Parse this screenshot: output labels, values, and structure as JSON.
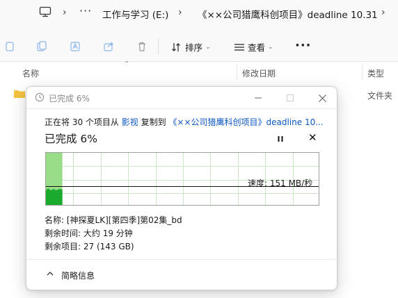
{
  "address_bar": {
    "breadcrumb": [
      "工作与学习 (E:)",
      "《××公司猎鹰科创项目》deadline 10.31"
    ],
    "more": "···"
  },
  "toolbar": {
    "sort_label": "排序",
    "view_label": "查看",
    "more": "···"
  },
  "file_list": {
    "columns": [
      "名称",
      "修改日期",
      "类型"
    ],
    "rows": [
      {
        "type": "文件夹"
      }
    ]
  },
  "copy_dialog": {
    "title": "已完成 6%",
    "copy_prefix": "正在将 30 个项目从",
    "source": "影视",
    "copy_mid": "复制到",
    "destination": "《××公司猎鹰科创项目》deadline 10...",
    "percent_label": "已完成 6%",
    "progress_fraction": 0.06,
    "speed": "速度: 151 MB/秒",
    "name_label": "名称:",
    "name_value": "[神探夏LK][第四季]第02集_bd",
    "time_label": "剩余时间:",
    "time_value": "大约 19 分钟",
    "items_label": "剩余项目:",
    "items_value": "27 (143 GB)",
    "details_toggle": "简略信息",
    "graph_color": "#99dd88",
    "fill_color": "#1aaa2e"
  }
}
